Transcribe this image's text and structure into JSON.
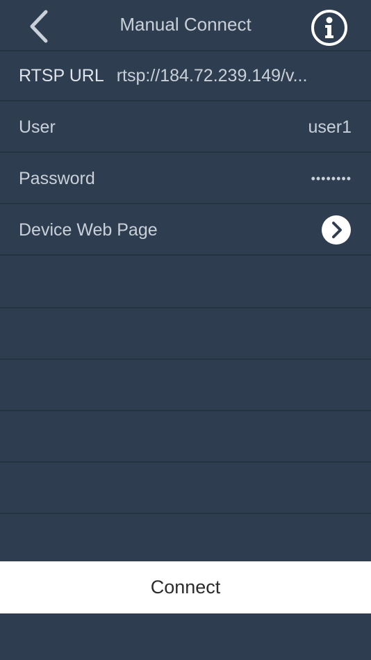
{
  "nav": {
    "title": "Manual Connect",
    "back_icon": "chevron-left-icon",
    "info_icon": "info-icon"
  },
  "fields": {
    "rtsp_url": {
      "label": "RTSP URL",
      "value": "rtsp://184.72.239.149/v..."
    },
    "user": {
      "label": "User",
      "value": "user1"
    },
    "password": {
      "label": "Password",
      "value": "••••••••"
    },
    "device_web_page": {
      "label": "Device Web Page",
      "icon": "chevron-right-circle-icon"
    }
  },
  "footer": {
    "connect_label": "Connect"
  },
  "colors": {
    "background": "#2e3d50",
    "divider": "#243241",
    "text": "#c9d0d8",
    "button_bg": "#ffffff"
  }
}
